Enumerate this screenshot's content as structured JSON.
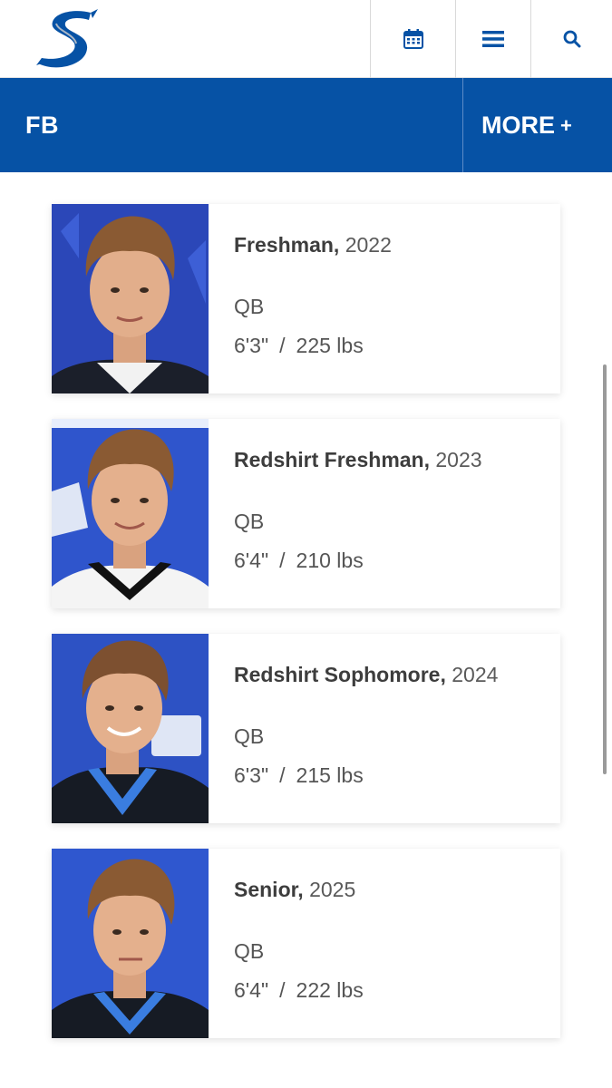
{
  "header": {
    "logo_icon": "school-s-logo",
    "calendar_icon": "calendar-icon",
    "menu_icon": "hamburger-menu-icon",
    "search_icon": "search-icon"
  },
  "nav": {
    "title": "FB",
    "more_label": "MORE",
    "more_plus": "+",
    "color": "#0652a5"
  },
  "roster": [
    {
      "class_label": "Freshman,",
      "year": "2022",
      "position": "QB",
      "height": "6'3\"",
      "separator": "/",
      "weight": "225 lbs"
    },
    {
      "class_label": "Redshirt Freshman,",
      "year": "2023",
      "position": "QB",
      "height": "6'4\"",
      "separator": "/",
      "weight": "210 lbs"
    },
    {
      "class_label": "Redshirt Sophomore,",
      "year": "2024",
      "position": "QB",
      "height": "6'3\"",
      "separator": "/",
      "weight": "215 lbs"
    },
    {
      "class_label": "Senior,",
      "year": "2025",
      "position": "QB",
      "height": "6'4\"",
      "separator": "/",
      "weight": "222 lbs"
    }
  ]
}
